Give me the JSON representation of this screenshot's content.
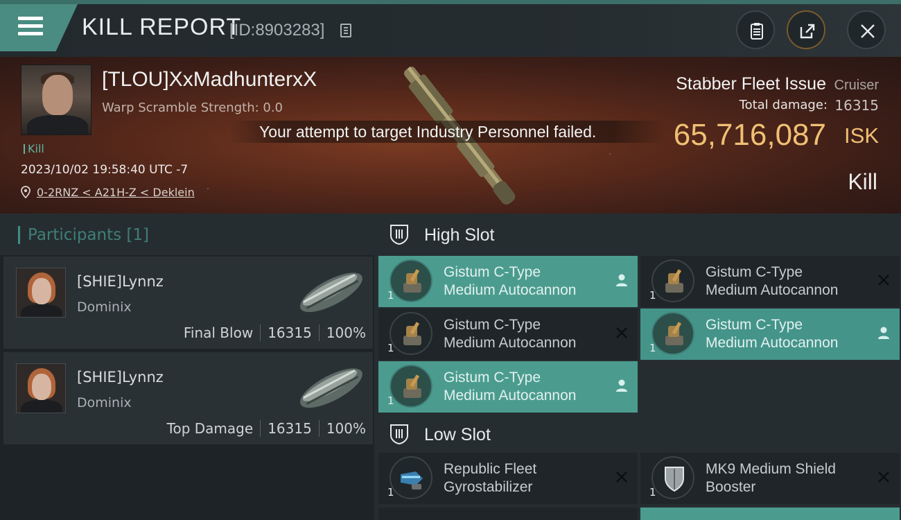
{
  "header": {
    "title": "KILL REPORT",
    "report_id": "[ID:8903283]",
    "icons": [
      "menu-icon",
      "copy-icon",
      "clipboard-icon",
      "share-icon",
      "close-icon"
    ]
  },
  "victim": {
    "name": "[TLOU]XxMadhunterxX",
    "warp_scramble": "Warp Scramble Strength: 0.0",
    "tag": "Kill",
    "datetime": "2023/10/02 19:58:40 UTC -7",
    "location": "0-2RNZ < A21H-Z < Deklein"
  },
  "toast": "Your attempt to target Industry Personnel failed.",
  "ship": {
    "name": "Stabber Fleet Issue",
    "class": "Cruiser",
    "total_damage_label": "Total damage:",
    "total_damage": "16315",
    "isk_value": "65,716,087",
    "isk_unit": "ISK",
    "result": "Kill"
  },
  "participants": {
    "title": "Participants [1]",
    "rows": [
      {
        "name": "[SHIE]Lynnz",
        "ship": "Dominix",
        "role": "Final Blow",
        "damage": "16315",
        "percent": "100%"
      },
      {
        "name": "[SHIE]Lynnz",
        "ship": "Dominix",
        "role": "Top Damage",
        "damage": "16315",
        "percent": "100%"
      }
    ]
  },
  "fitting": {
    "high_slot_title": "High Slot",
    "low_slot_title": "Low Slot",
    "high_slots": [
      {
        "line1": "Gistum C-Type",
        "line2": "Medium Autocannon",
        "qty": "1",
        "status": "person-icon"
      },
      {
        "line1": "Gistum C-Type",
        "line2": "Medium Autocannon",
        "qty": "1",
        "status": "destroyed-x-icon"
      },
      {
        "line1": "Gistum C-Type",
        "line2": "Medium Autocannon",
        "qty": "1",
        "status": "destroyed-x-icon"
      },
      {
        "line1": "Gistum C-Type",
        "line2": "Medium Autocannon",
        "qty": "1",
        "status": "person-icon"
      },
      {
        "line1": "Gistum C-Type",
        "line2": "Medium Autocannon",
        "qty": "1",
        "status": "person-icon"
      }
    ],
    "low_slots": [
      {
        "line1": "Republic Fleet",
        "line2": "Gyrostabilizer",
        "qty": "1",
        "status": "destroyed-x-icon"
      },
      {
        "line1": "MK9 Medium Shield",
        "line2": "Booster",
        "qty": "1",
        "status": "destroyed-x-icon"
      }
    ]
  },
  "colors": {
    "accent": "#4b9c8f",
    "isk": "#f0c074",
    "panel": "#262d31"
  }
}
